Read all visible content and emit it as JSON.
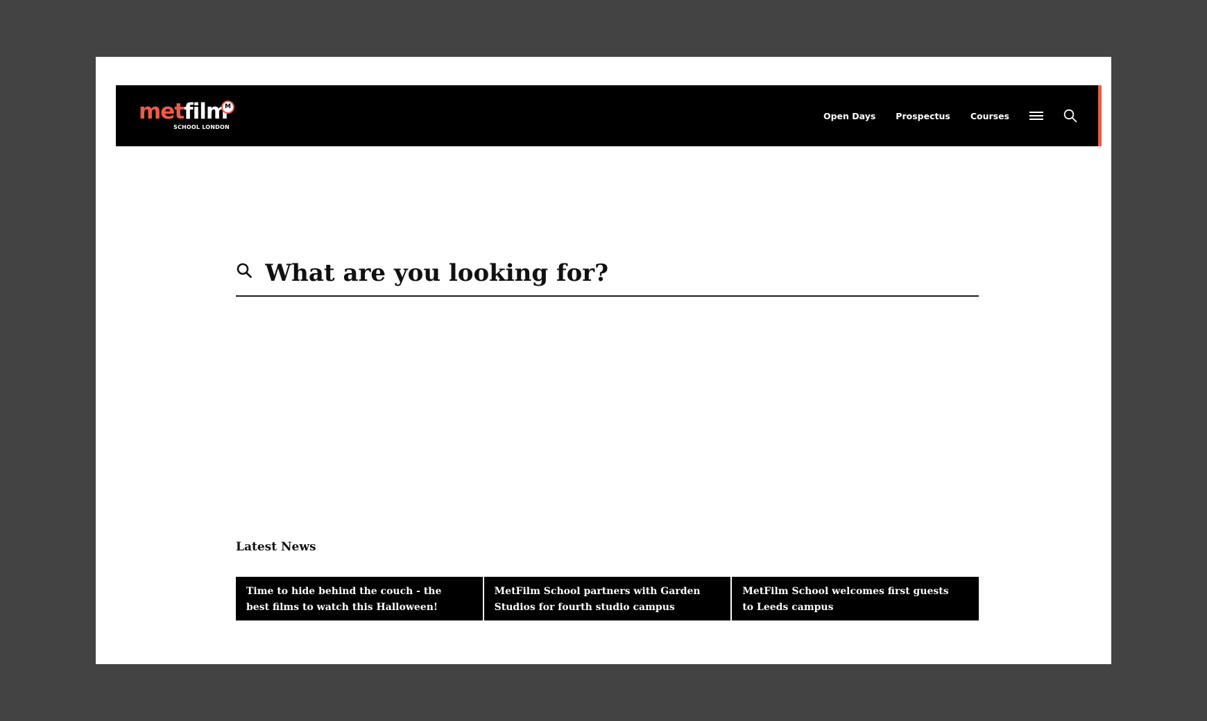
{
  "brand": {
    "logo_main_left": "met",
    "logo_main_right": "film",
    "logo_badge": "M",
    "logo_sub": "SCHOOL LONDON",
    "accent_color": "#ef5a46"
  },
  "nav": {
    "links": [
      "Open Days",
      "Prospectus",
      "Courses"
    ],
    "menu_icon": "hamburger-menu-icon",
    "search_icon": "search-icon"
  },
  "search": {
    "placeholder": "What are you looking for?",
    "icon": "search-icon"
  },
  "news": {
    "heading": "Latest News",
    "items": [
      {
        "title": "Time to hide behind the couch - the best films to watch this Halloween!"
      },
      {
        "title": "MetFilm School partners with Garden Studios for fourth studio campus"
      },
      {
        "title": "MetFilm School welcomes first guests to Leeds campus"
      }
    ]
  }
}
